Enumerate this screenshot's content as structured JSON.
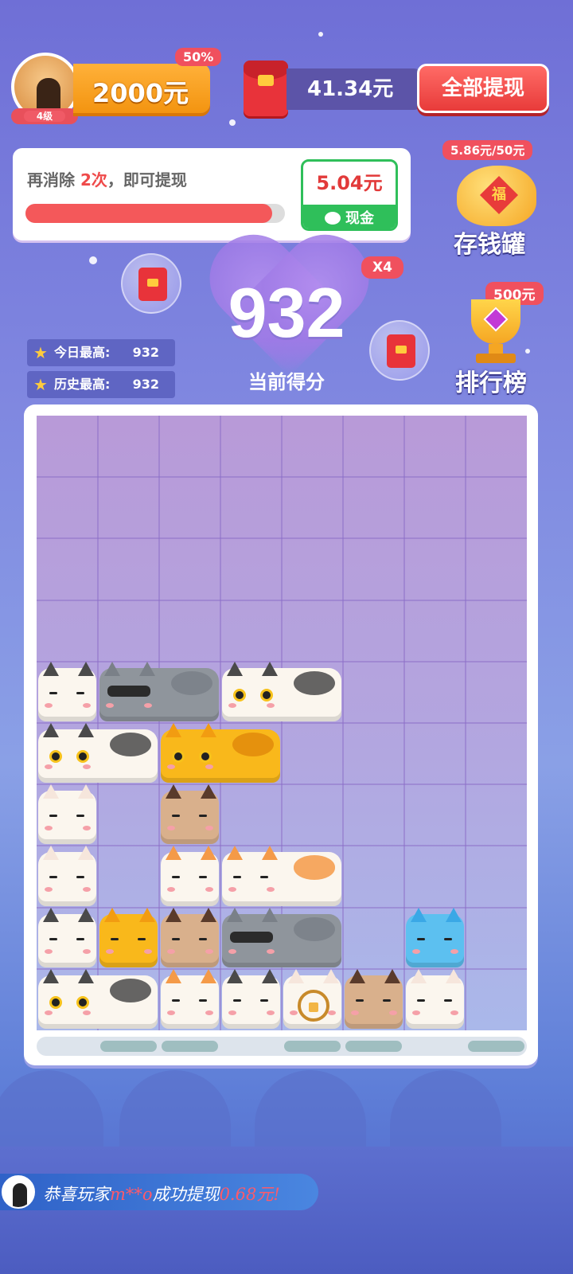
{
  "profile": {
    "level": "4级"
  },
  "coins": {
    "value": "2000元",
    "badge": "50%"
  },
  "wallet": {
    "amount": "41.34元",
    "withdraw_all": "全部提现"
  },
  "progress": {
    "msg_prefix": "再消除 ",
    "msg_count": "2次",
    "msg_suffix": "，即可提现",
    "fill_fraction": 0.95,
    "cash_amount": "5.04元",
    "cash_label": "现金"
  },
  "piggy": {
    "badge": "5.86元/50元",
    "label": "存钱罐",
    "emblem": "福"
  },
  "leaderboard": {
    "badge": "500元",
    "label": "排行榜"
  },
  "score": {
    "value": "932",
    "label": "当前得分",
    "multiplier": "X4"
  },
  "stats": {
    "today_label": "今日最高:",
    "today_value": "932",
    "history_label": "历史最高:",
    "history_value": "932"
  },
  "board": {
    "cols": 8,
    "rows": 10,
    "tray_filled_cols": [
      1,
      2,
      4,
      5,
      7
    ],
    "cats": [
      {
        "row": 4,
        "col": 0,
        "w": 1,
        "type": "tuxedo",
        "face": "sleepy"
      },
      {
        "row": 4,
        "col": 1,
        "w": 2,
        "type": "gray",
        "face": "shades"
      },
      {
        "row": 4,
        "col": 3,
        "w": 2,
        "type": "tuxedo",
        "face": "wide"
      },
      {
        "row": 5,
        "col": 0,
        "w": 2,
        "type": "tuxedo",
        "face": "wide"
      },
      {
        "row": 5,
        "col": 2,
        "w": 2,
        "type": "orange",
        "face": "wide"
      },
      {
        "row": 6,
        "col": 0,
        "w": 1,
        "type": "white",
        "face": "sleepy"
      },
      {
        "row": 6,
        "col": 2,
        "w": 1,
        "type": "siamese",
        "face": "sleepy"
      },
      {
        "row": 7,
        "col": 0,
        "w": 1,
        "type": "white",
        "face": "sleepy"
      },
      {
        "row": 7,
        "col": 2,
        "w": 1,
        "type": "calico",
        "face": "sleepy"
      },
      {
        "row": 7,
        "col": 3,
        "w": 2,
        "type": "calico",
        "face": "sleepy"
      },
      {
        "row": 8,
        "col": 0,
        "w": 1,
        "type": "tuxedo",
        "face": "sleepy"
      },
      {
        "row": 8,
        "col": 1,
        "w": 1,
        "type": "orange",
        "face": "sleepy"
      },
      {
        "row": 8,
        "col": 2,
        "w": 1,
        "type": "siamese",
        "face": "sleepy"
      },
      {
        "row": 8,
        "col": 3,
        "w": 2,
        "type": "gray",
        "face": "shades"
      },
      {
        "row": 8,
        "col": 6,
        "w": 1,
        "type": "blue",
        "face": "sleepy"
      },
      {
        "row": 9,
        "col": 0,
        "w": 2,
        "type": "tuxedo",
        "face": "wide"
      },
      {
        "row": 9,
        "col": 2,
        "w": 1,
        "type": "calico",
        "face": "sleepy"
      },
      {
        "row": 9,
        "col": 3,
        "w": 1,
        "type": "tuxedo",
        "face": "sleepy"
      },
      {
        "row": 9,
        "col": 4,
        "w": 1,
        "type": "white",
        "face": "locked"
      },
      {
        "row": 9,
        "col": 5,
        "w": 1,
        "type": "siamese",
        "face": "sleepy"
      },
      {
        "row": 9,
        "col": 6,
        "w": 1,
        "type": "white",
        "face": "sleepy"
      }
    ]
  },
  "cat_colors": {
    "tuxedo": {
      "body": "#fbf6ee",
      "ear": "#4a4a4a",
      "patch": "#4a4a4a"
    },
    "gray": {
      "body": "#8f959c",
      "ear": "#7a8088",
      "patch": "#7a8088"
    },
    "orange": {
      "body": "#f9b81b",
      "ear": "#f29c11",
      "patch": "#e28a0b"
    },
    "white": {
      "body": "#fbf6ee",
      "ear": "#f6e6dc",
      "patch": "#f6e6dc"
    },
    "siamese": {
      "body": "#d9b08c",
      "ear": "#5a3b2b",
      "patch": "#5a3b2b"
    },
    "calico": {
      "body": "#fbf6ee",
      "ear": "#f49a48",
      "patch": "#f49a48"
    },
    "blue": {
      "body": "#5cc0f0",
      "ear": "#3aa8e6",
      "patch": "#3aa8e6"
    }
  },
  "ticker": {
    "prefix": "恭喜玩家",
    "player": "m**o",
    "middle": "成功提现",
    "amount": "0.68元!"
  }
}
